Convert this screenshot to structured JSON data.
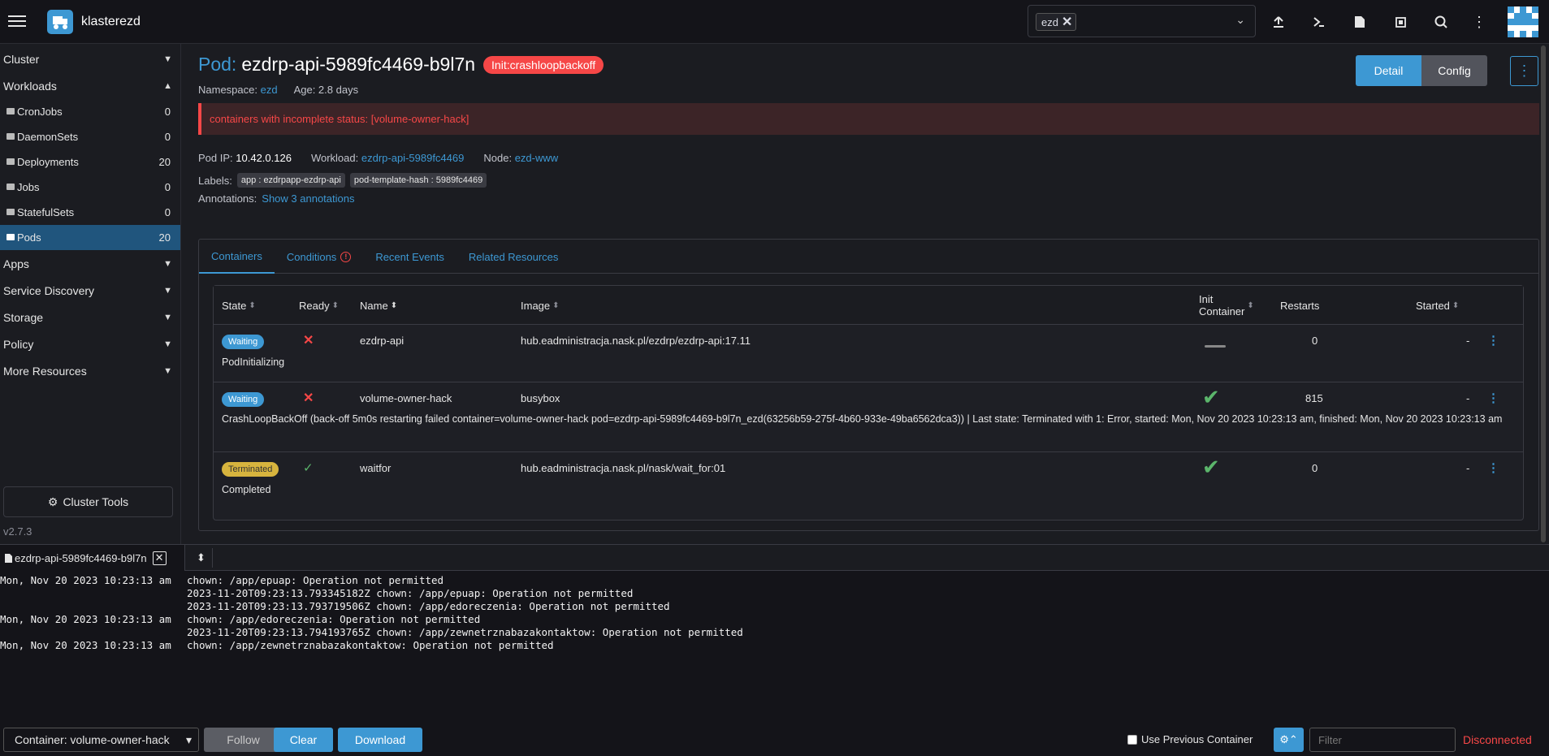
{
  "header": {
    "cluster_name": "klasterezd",
    "namespace_chip": "ezd",
    "icons": [
      "upload-icon",
      "terminal-icon",
      "file-icon",
      "copy-config-icon",
      "search-icon",
      "more-vert-icon"
    ]
  },
  "sidebar": {
    "groups": [
      {
        "label": "Cluster",
        "expanded": false
      },
      {
        "label": "Workloads",
        "expanded": true
      },
      {
        "label": "Apps",
        "expanded": false
      },
      {
        "label": "Service Discovery",
        "expanded": false
      },
      {
        "label": "Storage",
        "expanded": false
      },
      {
        "label": "Policy",
        "expanded": false
      },
      {
        "label": "More Resources",
        "expanded": false
      }
    ],
    "workloads": [
      {
        "label": "CronJobs",
        "count": "0"
      },
      {
        "label": "DaemonSets",
        "count": "0"
      },
      {
        "label": "Deployments",
        "count": "20"
      },
      {
        "label": "Jobs",
        "count": "0"
      },
      {
        "label": "StatefulSets",
        "count": "0"
      },
      {
        "label": "Pods",
        "count": "20",
        "active": true
      }
    ],
    "cluster_tools": "Cluster Tools",
    "version": "v2.7.3"
  },
  "page": {
    "kind": "Pod:",
    "name": "ezdrp-api-5989fc4469-b9l7n",
    "state": "Init:crashloopbackoff",
    "namespace_label": "Namespace:",
    "namespace": "ezd",
    "age": "Age: 2.8 days",
    "detail_btn": "Detail",
    "config_btn": "Config",
    "banner": "containers with incomplete status: [volume-owner-hack]",
    "pod_ip_label": "Pod IP:",
    "pod_ip": "10.42.0.126",
    "workload_label": "Workload:",
    "workload": "ezdrp-api-5989fc4469",
    "node_label": "Node:",
    "node": "ezd-www",
    "labels_label": "Labels:",
    "labels": [
      "app : ezdrpapp-ezdrp-api",
      "pod-template-hash : 5989fc4469"
    ],
    "annotations_label": "Annotations:",
    "annotations_link": "Show 3 annotations"
  },
  "tabs": [
    "Containers",
    "Conditions",
    "Recent Events",
    "Related Resources"
  ],
  "containers_table": {
    "headers": {
      "state": "State",
      "ready": "Ready",
      "name": "Name",
      "image": "Image",
      "init_1": "Init",
      "init_2": "Container",
      "restarts": "Restarts",
      "started": "Started"
    },
    "rows": [
      {
        "state": "Waiting",
        "name": "ezdrp-api",
        "image": "hub.eadministracja.nask.pl/ezdrp/ezdrp-api:17.11",
        "restarts": "0",
        "started": "-",
        "message": "PodInitializing"
      },
      {
        "state": "Waiting",
        "name": "volume-owner-hack",
        "image": "busybox",
        "restarts": "815",
        "started": "-",
        "message": "CrashLoopBackOff (back-off 5m0s restarting failed container=volume-owner-hack pod=ezdrp-api-5989fc4469-b9l7n_ezd(63256b59-275f-4b60-933e-49ba6562dca3)) | Last state: Terminated with 1: Error, started: Mon, Nov 20 2023 10:23:13 am, finished: Mon, Nov 20 2023 10:23:13 am"
      },
      {
        "state": "Terminated",
        "name": "waitfor",
        "image": "hub.eadministracja.nask.pl/nask/wait_for:01",
        "restarts": "0",
        "started": "-",
        "message": "Completed"
      }
    ]
  },
  "log_panel": {
    "tab_label": "ezdrp-api-5989fc4469-b9l7n",
    "lines": [
      {
        "time": "Mon, Nov 20 2023 10:23:13 am",
        "text": "chown: /app/epuap: Operation not permitted"
      },
      {
        "time": "",
        "text": "2023-11-20T09:23:13.793345182Z chown: /app/epuap: Operation not permitted"
      },
      {
        "time": "",
        "text": "2023-11-20T09:23:13.793719506Z chown: /app/edoreczenia: Operation not permitted"
      },
      {
        "time": "Mon, Nov 20 2023 10:23:13 am",
        "text": "chown: /app/edoreczenia: Operation not permitted"
      },
      {
        "time": "",
        "text": "2023-11-20T09:23:13.794193765Z chown: /app/zewnetrznabazakontaktow: Operation not permitted"
      },
      {
        "time": "Mon, Nov 20 2023 10:23:13 am",
        "text": "chown: /app/zewnetrznabazakontaktow: Operation not permitted"
      }
    ],
    "container_select": "Container: volume-owner-hack",
    "follow": "Follow",
    "clear": "Clear",
    "download": "Download",
    "use_previous": "Use Previous Container",
    "filter_placeholder": "Filter",
    "status": "Disconnected"
  }
}
